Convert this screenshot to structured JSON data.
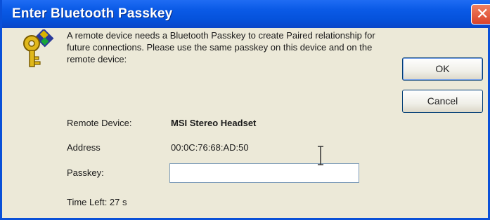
{
  "window": {
    "title": "Enter Bluetooth Passkey"
  },
  "message": "A remote device needs a Bluetooth Passkey to create Paired relationship for future connections. Please use the same passkey on this device and on the remote device:",
  "fields": {
    "remote_device": {
      "label": "Remote Device:",
      "value": "MSI Stereo Headset"
    },
    "address": {
      "label": "Address",
      "value": "00:0C:76:68:AD:50"
    },
    "passkey": {
      "label": "Passkey:",
      "value": ""
    }
  },
  "time_left": "Time Left: 27 s",
  "buttons": {
    "ok": "OK",
    "cancel": "Cancel"
  },
  "icons": {
    "dialog": "key-icon",
    "close": "close-icon",
    "cursor": "i-beam-cursor-icon"
  }
}
